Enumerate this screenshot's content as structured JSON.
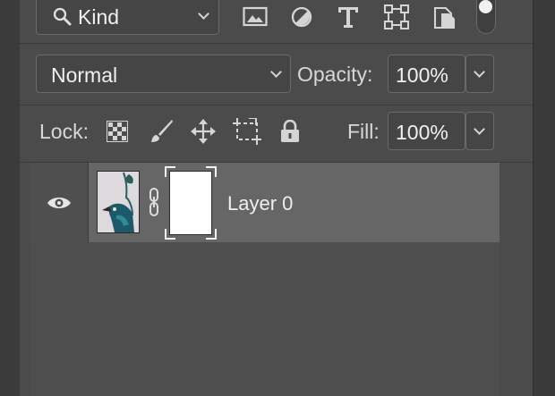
{
  "filter": {
    "kind_label": "Kind",
    "icons": [
      "search-icon",
      "image-filter-icon",
      "adjustment-filter-icon",
      "type-filter-icon",
      "shape-filter-icon",
      "smart-object-filter-icon",
      "filter-toggle"
    ]
  },
  "blend": {
    "mode": "Normal",
    "opacity_label": "Opacity:",
    "opacity_value": "100%"
  },
  "lock": {
    "label": "Lock:",
    "fill_label": "Fill:",
    "fill_value": "100%",
    "icons": [
      "lock-transparent-pixels-icon",
      "lock-image-pixels-icon",
      "lock-position-icon",
      "lock-artboard-icon",
      "lock-all-icon"
    ]
  },
  "layers": [
    {
      "name": "Layer 0",
      "visible": true,
      "selected": true
    }
  ]
}
